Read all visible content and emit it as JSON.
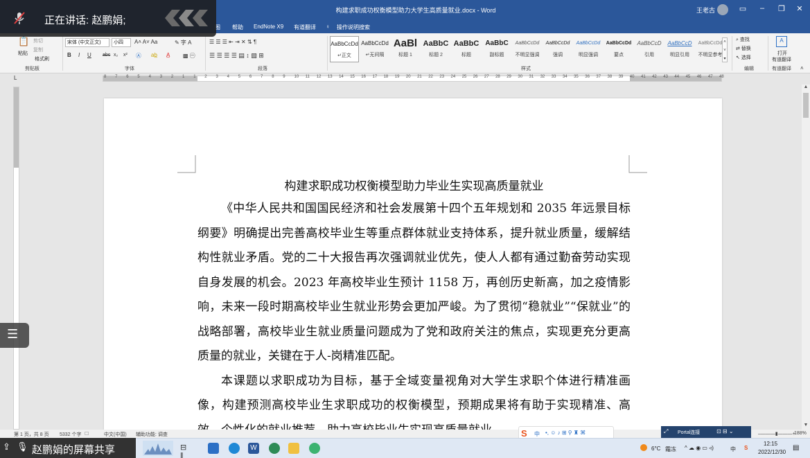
{
  "window": {
    "title": "构建求职成功权衡模型助力大学生高质量就业.docx - Word",
    "user": "王老古",
    "minimize_icon": "minimize-icon",
    "restore_icon": "restore-icon",
    "close_icon": "close-icon",
    "ribbon_display_icon": "ribbon-display-icon"
  },
  "ribbon_tabs": [
    "图",
    "帮助",
    "EndNote X9",
    "有道翻译",
    "操作说明搜索"
  ],
  "ribbon": {
    "clipboard": {
      "paste": "粘贴",
      "cut": "剪切",
      "copy": "复制",
      "format_painter": "格式刷",
      "group": "剪贴板"
    },
    "font": {
      "font_name": "宋体 (中文正文)",
      "font_size": "小四",
      "group": "字体",
      "bold": "B",
      "italic": "I",
      "underline": "U",
      "strike": "abc",
      "sub": "x₂",
      "sup": "x²"
    },
    "paragraph": {
      "group": "段落"
    },
    "styles": {
      "group": "样式",
      "items": [
        {
          "sample": "AaBbCcDd",
          "name": "↵正文"
        },
        {
          "sample": "AaBbCcDd",
          "name": "↵无间隔"
        },
        {
          "sample": "AaBl",
          "name": "标题 1"
        },
        {
          "sample": "AaBbC",
          "name": "标题 2"
        },
        {
          "sample": "AaBbC",
          "name": "标题"
        },
        {
          "sample": "AaBbC",
          "name": "副标题"
        },
        {
          "sample": "AaBbCcDd",
          "name": "不明显强调"
        },
        {
          "sample": "AaBbCcDd",
          "name": "强调"
        },
        {
          "sample": "AaBbCcDd",
          "name": "明显强调"
        },
        {
          "sample": "AaBbCcDd",
          "name": "要点"
        },
        {
          "sample": "AaBbCcD",
          "name": "引用"
        },
        {
          "sample": "AaBbCcD",
          "name": "明显引用"
        },
        {
          "sample": "AaBbCcDd",
          "name": "不明显参考"
        }
      ]
    },
    "editing": {
      "find": "查找",
      "replace": "替换",
      "select": "选择",
      "group": "编辑"
    },
    "translate": {
      "open": "打开",
      "label": "有道翻译",
      "group": "有道翻译"
    }
  },
  "ruler_numbers": [
    "8",
    "7",
    "6",
    "5",
    "4",
    "3",
    "2",
    "1",
    "1",
    "2",
    "3",
    "4",
    "5",
    "6",
    "7",
    "8",
    "9",
    "10",
    "11",
    "12",
    "13",
    "14",
    "15",
    "16",
    "17",
    "18",
    "19",
    "20",
    "21",
    "22",
    "23",
    "24",
    "25",
    "26",
    "27",
    "28",
    "29",
    "30",
    "31",
    "32",
    "33",
    "34",
    "35",
    "36",
    "37",
    "38",
    "39",
    "40",
    "41",
    "42",
    "43",
    "44",
    "45",
    "46",
    "47",
    "48"
  ],
  "document": {
    "heading": "构建求职成功权衡模型助力毕业生实现高质量就业",
    "paragraphs": [
      "《中华人民共和国国民经济和社会发展第十四个五年规划和 2035 年远景目标纲要》明确提出完善高校毕业生等重点群体就业支持体系，提升就业质量，缓解结构性就业矛盾。党的二十大报告再次强调就业优先，使人人都有通过勤奋劳动实现自身发展的机会。2023 年高校毕业生预计 1158 万，再创历史新高，加之疫情影响，未来一段时期高校毕业生就业形势会更加严峻。为了贯彻“稳就业”“保就业”的战略部署，高校毕业生就业质量问题成为了党和政府关注的焦点，实现更充分更高质量的就业，关键在于人-岗精准匹配。",
      "本课题以求职成功为目标，基于全域变量视角对大学生求职个体进行精准画像，构建预测高校毕业生求职成功的权衡模型，预期成果将有助于实现精准、高效、个性化的就业推荐，助力高校毕业生实现高质量就业。"
    ]
  },
  "statusbar": {
    "page": "第 1 页，共 8 页",
    "words": "5332 个字",
    "lang": "中文(中国)",
    "accessibility": "辅助功能: 调查",
    "zoom": "188%"
  },
  "screen_share": {
    "talking": "正在讲话: 赵鹏娟;",
    "sharing": "赵鹏娟的屏幕共享"
  },
  "ime": {
    "lang": "中",
    "panel_label": "Portal连接"
  },
  "tray": {
    "weather": "6°C",
    "weather_desc": "霜冻",
    "ime_lang": "中",
    "time": "12:15",
    "date": "2022/12/30"
  }
}
